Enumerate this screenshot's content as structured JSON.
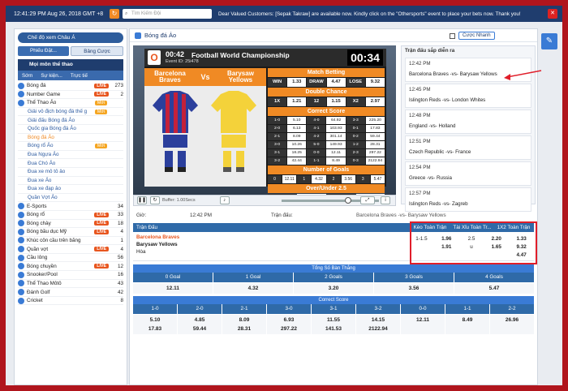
{
  "topbar": {
    "time": "12:41:29 PM Aug 26, 2018 GMT +8",
    "search_placeholder": "Tìm Kiếm Đội",
    "announcement": "Dear Valued Customers: [Sepak Takraw] are available now. Kindly click on the \"Othersports\" event to place your bets now. Thank you!"
  },
  "sidebar": {
    "mode_pill": "Chế độ xem Châu Á",
    "btn_phieu": "Phiếu Đặt...",
    "btn_bang": "Bảng Cược",
    "section_head": "Mọi môn thể thao",
    "tabs": [
      "Sớm",
      "Sự kiện...",
      "Trực tiế"
    ],
    "items": [
      {
        "label": "Bóng đá",
        "live": "LIVE",
        "count": "273"
      },
      {
        "label": "Number Game",
        "live": "LIVE",
        "count": "2"
      },
      {
        "label": "Thể Thao Ảo",
        "new": "Mới",
        "count": ""
      },
      {
        "label": "Giải vô địch bóng đá thế g",
        "new": "Mới",
        "count": "",
        "sub": true
      },
      {
        "label": "Giải đấu Bóng đá Ảo",
        "count": "",
        "sub": true
      },
      {
        "label": "Quốc gia Bóng đá Ảo",
        "count": "",
        "sub": true
      },
      {
        "label": "Bóng đá Ảo",
        "count": "",
        "sub": true,
        "sel": true
      },
      {
        "label": "Bóng rổ Ảo",
        "new": "Mới",
        "count": "",
        "sub": true
      },
      {
        "label": "Đua Ngựa Ảo",
        "count": "",
        "sub": true
      },
      {
        "label": "Đua Chó Ảo",
        "count": "",
        "sub": true
      },
      {
        "label": "Đua xe mô tô ảo",
        "count": "",
        "sub": true
      },
      {
        "label": "Đua xe Ảo",
        "count": "",
        "sub": true
      },
      {
        "label": "Đua xe đạp ảo",
        "count": "",
        "sub": true
      },
      {
        "label": "Quần Vợt Ảo",
        "count": "",
        "sub": true
      },
      {
        "label": "E-Sports",
        "count": "34"
      },
      {
        "label": "Bóng rổ",
        "live": "LIVE",
        "count": "33"
      },
      {
        "label": "Bóng chày",
        "live": "LIVE",
        "count": "18"
      },
      {
        "label": "Bóng bầu dục Mỹ",
        "live": "LIVE",
        "count": "4"
      },
      {
        "label": "Khúc côn cầu trên băng",
        "count": "1"
      },
      {
        "label": "Quần vợt",
        "live": "LIVE",
        "count": "4"
      },
      {
        "label": "Cầu lông",
        "count": "56"
      },
      {
        "label": "Bóng chuyền",
        "live": "LIVE",
        "count": "12"
      },
      {
        "label": "Snooker/Pool",
        "count": "16"
      },
      {
        "label": "Thể Thao Môtô",
        "count": "43"
      },
      {
        "label": "Đánh Golf",
        "count": "42"
      },
      {
        "label": "Cricket",
        "count": "8"
      }
    ]
  },
  "main": {
    "title": "Bóng đá Ảo",
    "cuoc_nhanh": "Cược Nhanh"
  },
  "scoreboard": {
    "time": "00:42",
    "event_id": "Event ID: 25i478",
    "championship": "Football World Championship",
    "clock": "00:34",
    "team1": "Barcelona Braves",
    "vs": "Vs",
    "team2": "Barysaw Yellows",
    "match_betting": "Match Betting",
    "mb_row": [
      "WIN",
      "1.33",
      "DRAW",
      "4.47",
      "LOSE",
      "9.32"
    ],
    "double_chance": "Double Chance",
    "dc_row": [
      "1X",
      "1.21",
      "12",
      "1.15",
      "X2",
      "2.97"
    ],
    "correct_score": "Correct Score",
    "cs_rows": [
      [
        "1-0",
        "5.10",
        "4-0",
        "64.92",
        "3-3",
        "225.20"
      ],
      [
        "2-0",
        "6.13",
        "4-1",
        "103.93",
        "0-1",
        "17.83"
      ],
      [
        "2-1",
        "8.09",
        "4-2",
        "301.14",
        "0-2",
        "59.44"
      ],
      [
        "3-0",
        "10.26",
        "5-0",
        "149.93",
        "1-2",
        "28.31"
      ],
      [
        "3-1",
        "18.25",
        "0-0",
        "12.11",
        "2-3",
        "297.22"
      ],
      [
        "3-2",
        "42.44",
        "1-1",
        "8.49",
        "0-3",
        "2122.94"
      ]
    ],
    "number_goals": "Number of Goals",
    "ng_row": [
      "0",
      "12.11",
      "1",
      "4.32",
      "2",
      "3.56",
      "3",
      "5.47"
    ],
    "over_under": "Over/Under 2.5",
    "ou_row": [
      "Over 2.5",
      "2.20",
      "Under 2.5",
      "1.65"
    ]
  },
  "player": {
    "buffer": "Buffer: 1.00Secs"
  },
  "info": {
    "gio_label": "Giờ:",
    "gio_value": "12:42 PM",
    "tran_label": "Trận đấu:",
    "tran_value": "Barcelona Braves -vs- Barysaw Yellows"
  },
  "upcoming": {
    "heading": "Trận đấu sắp diễn ra",
    "items": [
      {
        "time": "12:42 PM",
        "match": "Barcelona Braves -vs- Barysaw Yellows"
      },
      {
        "time": "12:45 PM",
        "match": "Islington Reds -vs- London Whites"
      },
      {
        "time": "12:48 PM",
        "match": "England -vs- Holland"
      },
      {
        "time": "12:51 PM",
        "match": "Czech Republic -vs- France"
      },
      {
        "time": "12:54 PM",
        "match": "Greece -vs- Russia"
      },
      {
        "time": "12:57 PM",
        "match": "Islington Reds -vs- Zagreb"
      }
    ]
  },
  "match_table": {
    "head_match": "Trận Đấu",
    "head_cols": [
      "Kèo Toàn Trận",
      "Tài Xỉu Toàn Tr...",
      "1X2 Toàn Trận"
    ],
    "team1": "Barcelona Braves",
    "team2": "Barysaw Yellows",
    "draw": "Hòa",
    "hdp_line": "1-1.5",
    "hdp": [
      "1.96",
      "1.91"
    ],
    "ou_line": [
      "2.5",
      "u"
    ],
    "ou": [
      "2.20",
      "1.65"
    ],
    "x12": [
      "1.33",
      "9.32",
      "4.47"
    ]
  },
  "goals": {
    "section": "Tổng Số Bàn Thắng",
    "heads": [
      "0 Goal",
      "1 Goal",
      "2 Goals",
      "3 Goals",
      "4 Goals"
    ],
    "values": [
      "12.11",
      "4.32",
      "3.20",
      "3.56",
      "5.47"
    ]
  },
  "correct_score": {
    "section": "Correct Score",
    "heads": [
      "1-0",
      "2-0",
      "2-1",
      "3-0",
      "3-1",
      "3-2",
      "0-0",
      "1-1",
      "2-2"
    ],
    "row1": [
      "5.10",
      "4.85",
      "8.09",
      "6.93",
      "11.55",
      "14.15",
      "12.11",
      "8.49",
      "26.96"
    ],
    "row2": [
      "17.83",
      "59.44",
      "28.31",
      "297.22",
      "141.53",
      "2122.94"
    ]
  },
  "colors": {
    "frame": "#b0151d",
    "navy": "#1f3d6e",
    "accent_orange": "#f08a24",
    "annotation_red": "#e01e2a"
  }
}
